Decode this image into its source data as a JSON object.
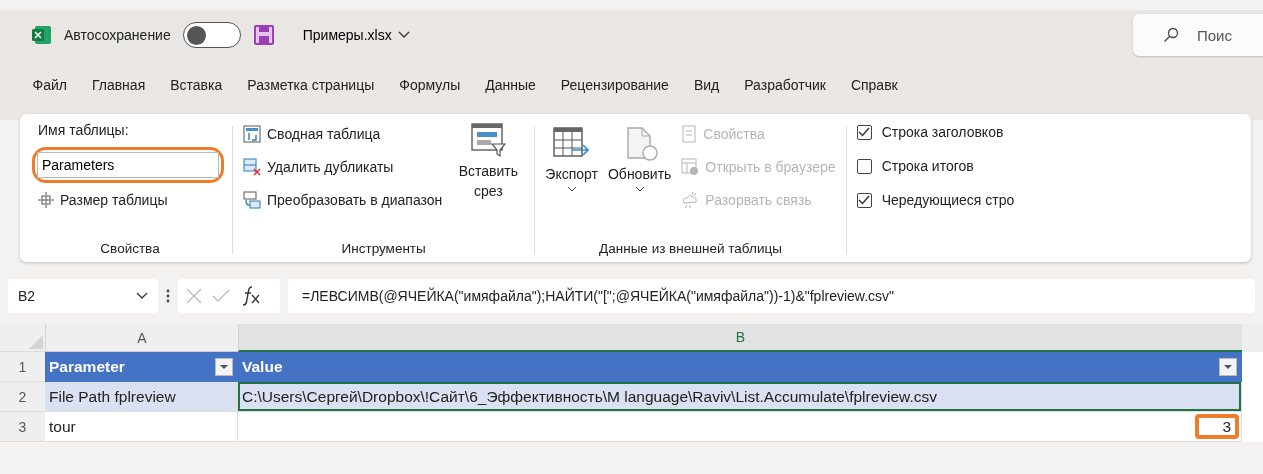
{
  "title_bar": {
    "autosave": {
      "label": "Автосохранение",
      "on": false
    },
    "file_name": "Примеры.xlsx",
    "search_placeholder": "Поис"
  },
  "tabs": [
    "Файл",
    "Главная",
    "Вставка",
    "Разметка страницы",
    "Формулы",
    "Данные",
    "Рецензирование",
    "Вид",
    "Разработчик",
    "Справк"
  ],
  "ribbon": {
    "properties": {
      "table_name_label": "Имя таблицы:",
      "table_name": "Parameters",
      "highlighted": true,
      "resize": "Размер таблицы",
      "group_label": "Свойства"
    },
    "tools": {
      "items": [
        {
          "kind": "pivot",
          "label": "Сводная таблица"
        },
        {
          "kind": "dedupe",
          "label": "Удалить дубликаты"
        },
        {
          "kind": "convert",
          "label": "Преобразовать в диапазон"
        }
      ],
      "slicer": "Вставить срез",
      "group_label": "Инструменты"
    },
    "external": {
      "export": "Экспорт",
      "refresh": "Обновить",
      "items": [
        {
          "kind": "props",
          "label": "Свойства",
          "disabled": true
        },
        {
          "kind": "browser",
          "label": "Открыть в браузере",
          "disabled": true
        },
        {
          "kind": "unlink",
          "label": "Разорвать связь",
          "disabled": true
        }
      ],
      "group_label": "Данные из внешней таблицы"
    },
    "style_options": [
      {
        "label": "Строка заголовков",
        "checked": true
      },
      {
        "label": "Строка итогов",
        "checked": false
      },
      {
        "label": "Чередующиеся стро",
        "checked": true
      }
    ]
  },
  "formula_bar": {
    "name_box": "B2",
    "formula": "=ЛЕВСИМВ(@ЯЧЕЙКА(\"имяфайла\");НАЙТИ(\"[\";@ЯЧЕЙКА(\"имяфайла\"))-1)&\"fplreview.csv\""
  },
  "sheet": {
    "columns": [
      "A",
      "B"
    ],
    "rows": [
      {
        "number": "1",
        "kind": "header",
        "cells": [
          {
            "text": "Parameter",
            "selected": false,
            "highlighted": false
          },
          {
            "text": "Value",
            "selected": false,
            "highlighted": false
          }
        ]
      },
      {
        "number": "2",
        "kind": "data",
        "cells": [
          {
            "text": "File Path fplreview",
            "selected": false,
            "highlighted": false
          },
          {
            "text": "C:\\Users\\Сергей\\Dropbox\\!Сайт\\6_Эффективность\\M language\\Raviv\\List.Accumulate\\fplreview.csv",
            "selected": true,
            "highlighted": false
          }
        ]
      },
      {
        "number": "3",
        "kind": "plain",
        "cells": [
          {
            "text": "tour",
            "selected": false,
            "highlighted": false
          },
          {
            "text": "3",
            "selected": false,
            "highlighted": true,
            "kind": "number"
          }
        ]
      }
    ]
  }
}
